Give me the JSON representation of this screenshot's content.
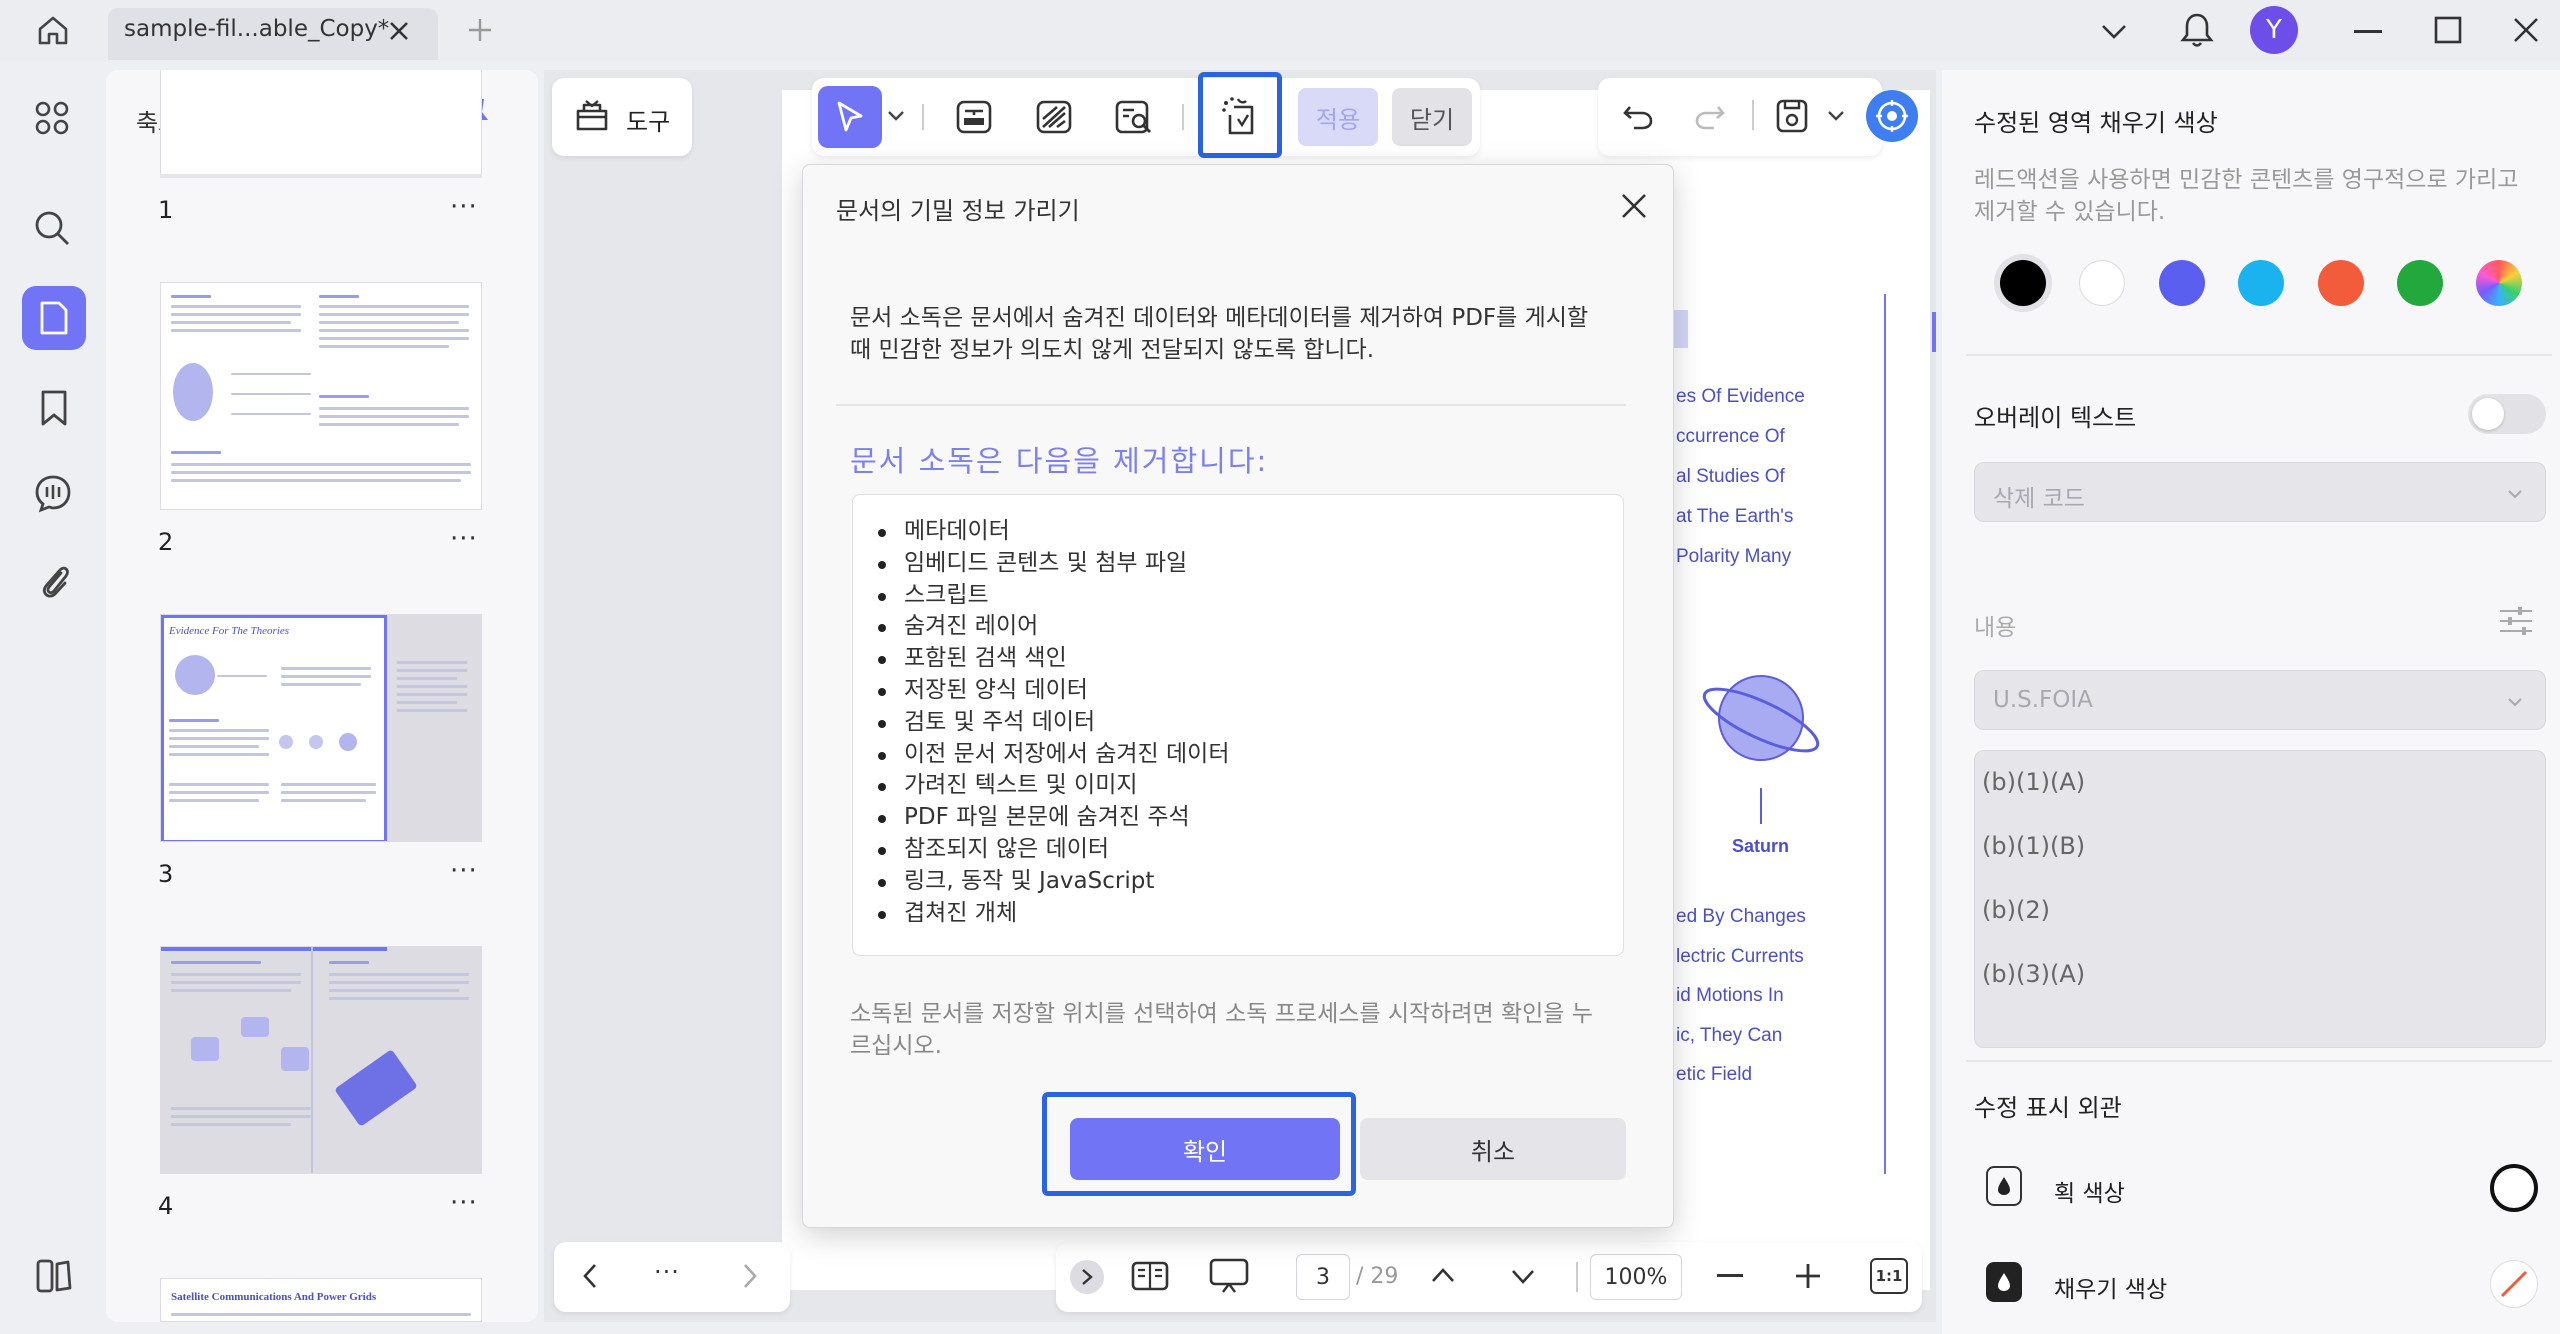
{
  "window": {
    "tab_title": "sample-fil...able_Copy*",
    "user_initial": "Y"
  },
  "thumbnails": {
    "title": "축소판",
    "pages": [
      {
        "number": "1"
      },
      {
        "number": "2"
      },
      {
        "number": "3",
        "heading": "Evidence For The Theories"
      },
      {
        "number": "4"
      },
      {
        "number": "",
        "heading": "Satellite Communications And Power Grids"
      }
    ],
    "more": "···"
  },
  "toolbar": {
    "tools_label": "도구",
    "apply_label": "적용",
    "close_label": "닫기"
  },
  "document_page": {
    "lines": [
      "es Of Evidence",
      "ccurrence Of",
      "al Studies Of",
      "at The Earth's",
      "Polarity Many"
    ],
    "lines2": [
      "ed By Changes",
      "lectric Currents",
      "id Motions In",
      "ic, They Can",
      "etic Field"
    ],
    "caption": "Saturn"
  },
  "bottom_bar": {
    "current_page": "3",
    "total_pages": "/ 29",
    "zoom": "100%",
    "fit_label": "1:1",
    "more": "···"
  },
  "dialog": {
    "title": "문서의 기밀 정보 가리기",
    "description": "문서 소독은 문서에서 숨겨진 데이터와 메타데이터를 제거하여 PDF를 게시할 때 민감한 정보가 의도치 않게 전달되지 않도록 합니다.",
    "subtitle": "문서 소독은 다음을 제거합니다:",
    "items": [
      "메타데이터",
      "임베디드 콘텐츠 및 첨부 파일",
      "스크립트",
      "숨겨진 레이어",
      "포함된 검색 색인",
      "저장된 양식 데이터",
      "검토 및 주석 데이터",
      "이전 문서 저장에서 숨겨진 데이터",
      "가려진 텍스트 및 이미지",
      "PDF 파일 본문에 숨겨진 주석",
      "참조되지 않은 데이터",
      "링크, 동작 및 JavaScript",
      "겹쳐진 개체"
    ],
    "footer": "소독된 문서를 저장할 위치를 선택하여 소독 프로세스를 시작하려면 확인을 누르십시오.",
    "confirm_label": "확인",
    "cancel_label": "취소"
  },
  "right_panel": {
    "fill_color_title": "수정된 영역 채우기 색상",
    "fill_color_desc": "레드액션을 사용하면 민감한 콘텐츠를 영구적으로 가리고 제거할 수 있습니다.",
    "swatches": [
      "#000000",
      "#ffffff",
      "#5b5ff0",
      "#1ab3ef",
      "#f25c3b",
      "#22a83d",
      "rainbow"
    ],
    "overlay_text_label": "오버레이 텍스트",
    "overlay_enabled": false,
    "code_select_placeholder": "삭제 코드",
    "content_label": "내용",
    "content_select_value": "U.S.FOIA",
    "codes": [
      "(b)(1)(A)",
      "(b)(1)(B)",
      "(b)(2)",
      "(b)(3)(A)"
    ],
    "appearance_title": "수정 표시 외관",
    "stroke_color_label": "획 색상",
    "fill_color_label": "채우기 색상",
    "accent": "#7174f5",
    "highlight": "#2b64e0"
  }
}
